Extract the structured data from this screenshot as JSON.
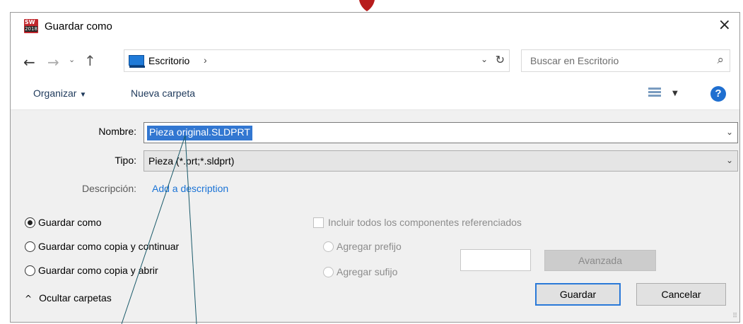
{
  "window": {
    "title": "Guardar como",
    "app_icon": "solidworks-2018-icon",
    "close_glyph": "×"
  },
  "nav": {
    "back_glyph": "←",
    "forward_glyph": "→",
    "recent_glyph": "⌄",
    "up_glyph": "↑",
    "location": "Escritorio",
    "location_sep": "›",
    "dropdown_glyph": "⌄",
    "refresh_glyph": "↻",
    "search_placeholder": "Buscar en Escritorio",
    "search_glyph": "⌕"
  },
  "toolbar": {
    "organize_label": "Organizar",
    "organize_caret": "▼",
    "new_folder_label": "Nueva carpeta",
    "view_caret": "▼",
    "help_glyph": "?"
  },
  "form": {
    "name_label": "Nombre:",
    "name_value": "Pieza original.SLDPRT",
    "name_dropdown": "⌄",
    "type_label": "Tipo:",
    "type_value": "Pieza (*.prt;*.sldprt)",
    "type_dropdown": "⌄",
    "description_label": "Descripción:",
    "description_link": "Add a description"
  },
  "save_options": [
    {
      "label": "Guardar como",
      "selected": true
    },
    {
      "label": "Guardar como copia y continuar",
      "selected": false
    },
    {
      "label": "Guardar como copia y abrir",
      "selected": false
    }
  ],
  "references": {
    "include_label": "Incluir todos los componentes referenciados",
    "prefix_label": "Agregar prefijo",
    "suffix_label": "Agregar sufijo",
    "prefix_value": "",
    "advanced_label": "Avanzada"
  },
  "footer": {
    "hide_folders_glyph": "^",
    "hide_folders_label": "Ocultar carpetas",
    "save_label": "Guardar",
    "cancel_label": "Cancelar",
    "grip_glyph": "⠿"
  },
  "colors": {
    "selection": "#3277d1",
    "link": "#1a73d6",
    "default_button_border": "#2a79d8",
    "help_icon": "#1f6fd0",
    "app_icon": "#c1272d",
    "annotation_marker": "#b71c1c"
  }
}
